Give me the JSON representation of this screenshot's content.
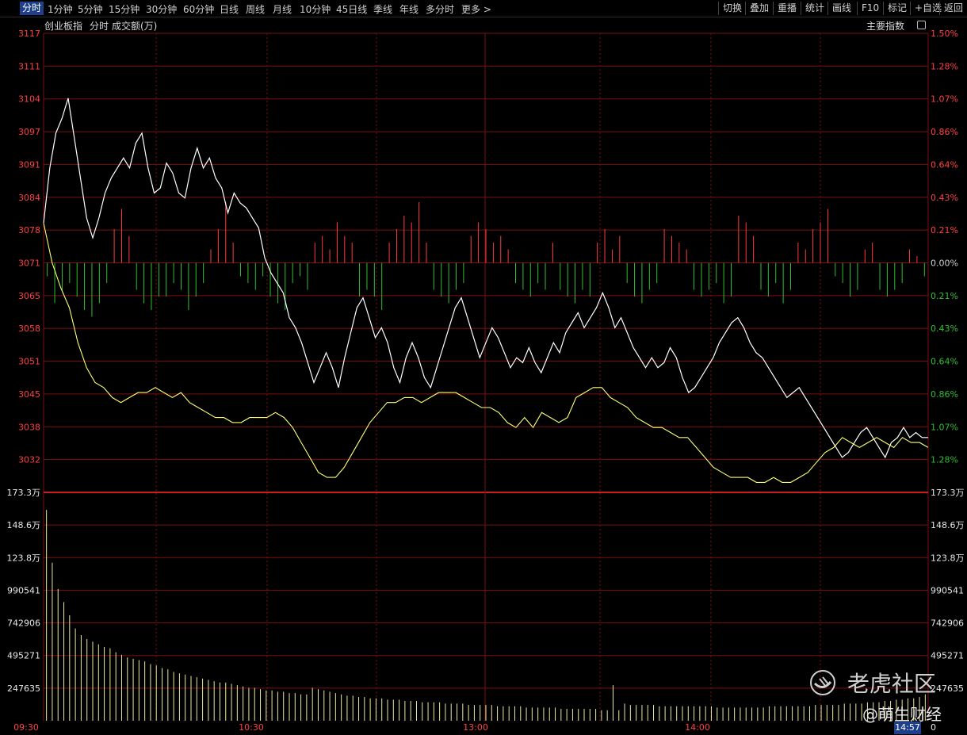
{
  "toolbar": {
    "periods": [
      "分时",
      "1分钟",
      "5分钟",
      "15分钟",
      "30分钟",
      "60分钟",
      "日线",
      "周线",
      "月线",
      "10分钟",
      "45日线",
      "季线",
      "年线",
      "多分时",
      "更多 >"
    ],
    "actions": [
      "切换",
      "叠加",
      "重播",
      "统计",
      "画线",
      "F10",
      "标记",
      "+自选",
      "返回"
    ]
  },
  "info": {
    "name": "创业板指",
    "period": "分时",
    "volume_label": "成交额(万)",
    "main_index": "主要指数"
  },
  "watermark": {
    "brand": "老虎社区",
    "author": "@萌生财经"
  },
  "colors": {
    "up": "#ff3b3b",
    "down": "#2fbf2f",
    "grid": "#7a0f0f",
    "price": "#ffffff",
    "avg": "#ffff70",
    "axis_left": "#ff4040",
    "axis_vol": "#e8e8e8"
  },
  "chart_data": [
    {
      "type": "line",
      "name": "price",
      "y_ticks": [
        "3117",
        "3111",
        "3104",
        "3097",
        "3091",
        "3084",
        "3078",
        "3071",
        "3065",
        "3058",
        "3051",
        "3045",
        "3038",
        "3032"
      ],
      "y_ticks_right": [
        "1.50%",
        "1.28%",
        "1.07%",
        "0.86%",
        "0.64%",
        "0.43%",
        "0.21%",
        "0.00%",
        "0.21%",
        "0.43%",
        "0.64%",
        "0.86%",
        "1.07%",
        "1.28%"
      ],
      "ylim": [
        3025,
        3117
      ],
      "series": [
        {
          "values": [
            3079,
            3090,
            3097,
            3100,
            3104,
            3096,
            3088,
            3080,
            3076,
            3080,
            3085,
            3088,
            3090,
            3092,
            3090,
            3095,
            3097,
            3090,
            3085,
            3086,
            3091,
            3089,
            3085,
            3084,
            3090,
            3094,
            3090,
            3092,
            3088,
            3086,
            3081,
            3085,
            3083,
            3082,
            3080,
            3078,
            3072,
            3069,
            3067,
            3065,
            3060,
            3058,
            3055,
            3051,
            3047,
            3050,
            3053,
            3050,
            3046,
            3052,
            3057,
            3062,
            3064,
            3060,
            3056,
            3058,
            3055,
            3050,
            3047,
            3052,
            3055,
            3052,
            3048,
            3046,
            3050,
            3054,
            3058,
            3062,
            3064,
            3060,
            3056,
            3052,
            3055,
            3058,
            3056,
            3053,
            3050,
            3052,
            3051,
            3054,
            3051,
            3049,
            3052,
            3055,
            3053,
            3057,
            3059,
            3061,
            3058,
            3060,
            3062,
            3065,
            3062,
            3058,
            3060,
            3057,
            3054,
            3052,
            3050,
            3052,
            3050,
            3051,
            3054,
            3052,
            3048,
            3045,
            3046,
            3048,
            3050,
            3052,
            3055,
            3057,
            3059,
            3060,
            3058,
            3055,
            3053,
            3052,
            3050,
            3048,
            3046,
            3044,
            3045,
            3046,
            3044,
            3042,
            3040,
            3038,
            3036,
            3034,
            3032,
            3033,
            3035,
            3037,
            3038,
            3036,
            3034,
            3032,
            3035,
            3036,
            3038,
            3036,
            3037,
            3036,
            3036
          ],
          "name": ""
        },
        {
          "values": [
            3079,
            3071,
            3066,
            3062,
            3055,
            3050,
            3047,
            3046,
            3044,
            3043,
            3044,
            3045,
            3045,
            3046,
            3045,
            3044,
            3045,
            3043,
            3042,
            3041,
            3040,
            3040,
            3039,
            3039,
            3040,
            3040,
            3040,
            3041,
            3040,
            3038,
            3035,
            3032,
            3029,
            3028,
            3028,
            3030,
            3033,
            3036,
            3039,
            3041,
            3043,
            3043,
            3044,
            3044,
            3043,
            3044,
            3045,
            3045,
            3045,
            3044,
            3043,
            3042,
            3042,
            3041,
            3039,
            3038,
            3040,
            3038,
            3041,
            3040,
            3039,
            3040,
            3044,
            3045,
            3046,
            3046,
            3044,
            3043,
            3042,
            3040,
            3039,
            3038,
            3038,
            3037,
            3036,
            3036,
            3034,
            3032,
            3030,
            3029,
            3028,
            3028,
            3028,
            3027,
            3027,
            3028,
            3027,
            3027,
            3028,
            3029,
            3031,
            3033,
            3034,
            3036,
            3035,
            3034,
            3035,
            3036,
            3035,
            3034,
            3036,
            3035,
            3035,
            3034
          ],
          "name": ""
        }
      ]
    },
    {
      "type": "bar",
      "name": "market-breadth",
      "values": [
        -2,
        -6,
        -4,
        -3,
        -5,
        -7,
        -8,
        -6,
        -3,
        5,
        8,
        4,
        -4,
        -6,
        -7,
        -5,
        -5,
        -3,
        -4,
        -7,
        -5,
        -3,
        2,
        5,
        9,
        3,
        -2,
        -3,
        -4,
        -2,
        -5,
        -6,
        -7,
        -3,
        -2,
        -4,
        3,
        4,
        2,
        6,
        4,
        3,
        -5,
        -4,
        -5,
        -7,
        3,
        5,
        7,
        6,
        9,
        3,
        -4,
        -5,
        -6,
        -4,
        -3,
        4,
        6,
        5,
        3,
        4,
        2,
        -3,
        -4,
        -5,
        -3,
        -4,
        3,
        -4,
        -5,
        -6,
        -4,
        -5,
        3,
        5,
        2,
        4,
        -3,
        -5,
        -6,
        -4,
        -3,
        5,
        4,
        3,
        2,
        -4,
        -5,
        -4,
        -3,
        -6,
        -5,
        7,
        6,
        4,
        -4,
        -5,
        -3,
        -6,
        -4,
        3,
        2,
        5,
        6,
        8,
        -2,
        -3,
        -5,
        -4,
        2,
        3,
        -4,
        -5,
        -4,
        -3,
        2,
        1,
        -2
      ],
      "ylim": [
        -10,
        10
      ]
    },
    {
      "type": "bar",
      "name": "volume",
      "y_ticks": [
        "173.3万",
        "148.6万",
        "123.8万",
        "990541",
        "742906",
        "495271",
        "247635",
        "0"
      ],
      "ylim": [
        0,
        1733000
      ],
      "values": [
        1600000,
        1200000,
        1000000,
        900000,
        800000,
        700000,
        650000,
        620000,
        600000,
        580000,
        560000,
        550000,
        520000,
        500000,
        480000,
        470000,
        460000,
        450000,
        430000,
        420000,
        400000,
        390000,
        370000,
        360000,
        350000,
        340000,
        330000,
        320000,
        310000,
        300000,
        290000,
        290000,
        280000,
        270000,
        260000,
        250000,
        250000,
        240000,
        230000,
        230000,
        220000,
        220000,
        210000,
        210000,
        200000,
        200000,
        250000,
        240000,
        230000,
        220000,
        210000,
        200000,
        190000,
        190000,
        180000,
        180000,
        170000,
        170000,
        170000,
        160000,
        160000,
        160000,
        150000,
        150000,
        150000,
        140000,
        140000,
        140000,
        140000,
        130000,
        130000,
        130000,
        130000,
        120000,
        120000,
        120000,
        120000,
        120000,
        110000,
        110000,
        110000,
        110000,
        110000,
        100000,
        100000,
        100000,
        100000,
        100000,
        100000,
        90000,
        90000,
        90000,
        90000,
        90000,
        90000,
        90000,
        80000,
        80000,
        270000,
        80000,
        130000,
        120000,
        120000,
        120000,
        120000,
        120000,
        110000,
        110000,
        110000,
        110000,
        110000,
        110000,
        110000,
        110000,
        110000,
        110000,
        100000,
        100000,
        100000,
        100000,
        100000,
        100000,
        100000,
        100000,
        100000,
        110000,
        110000,
        110000,
        110000,
        110000,
        110000,
        110000,
        110000,
        120000,
        120000,
        120000,
        120000,
        120000,
        130000,
        130000,
        130000,
        130000,
        140000,
        140000,
        140000,
        150000,
        150000,
        160000,
        160000,
        170000,
        170000,
        180000,
        200000
      ]
    }
  ],
  "x_ticks": [
    "09:30",
    "10:30",
    "13:00",
    "14:00",
    "14:57"
  ]
}
